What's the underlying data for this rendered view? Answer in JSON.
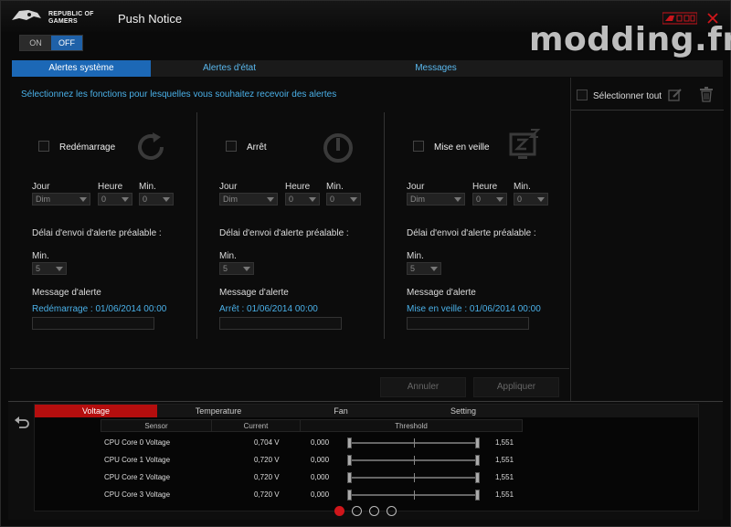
{
  "app": {
    "brand_line1": "REPUBLIC OF",
    "brand_line2": "GAMERS",
    "title": "Push Notice",
    "watermark": "modding.fr"
  },
  "toggle": {
    "on_label": "ON",
    "off_label": "OFF",
    "state": "off"
  },
  "tabs": [
    {
      "label": "Alertes système",
      "active": true
    },
    {
      "label": "Alertes d'état",
      "active": false
    },
    {
      "label": "Messages",
      "active": false
    }
  ],
  "main": {
    "instruction": "Sélectionnez les fonctions pour lesquelles vous souhaitez recevoir des alertes",
    "columns": [
      {
        "title": "Redémarrage",
        "icon": "restart-icon",
        "day_label": "Jour",
        "hour_label": "Heure",
        "min_label": "Min.",
        "day_value": "Dim",
        "hour_value": "0",
        "min_value": "0",
        "delay_label": "Délai d'envoi d'alerte préalable :",
        "delay_min_label": "Min.",
        "delay_value": "5",
        "message_label": "Message d'alerte",
        "message_value": "Redémarrage : 01/06/2014 00:00"
      },
      {
        "title": "Arrêt",
        "icon": "power-icon",
        "day_label": "Jour",
        "hour_label": "Heure",
        "min_label": "Min.",
        "day_value": "Dim",
        "hour_value": "0",
        "min_value": "0",
        "delay_label": "Délai d'envoi d'alerte préalable :",
        "delay_min_label": "Min.",
        "delay_value": "5",
        "message_label": "Message d'alerte",
        "message_value": "Arrêt : 01/06/2014 00:00"
      },
      {
        "title": "Mise en veille",
        "icon": "sleep-icon",
        "day_label": "Jour",
        "hour_label": "Heure",
        "min_label": "Min.",
        "day_value": "Dim",
        "hour_value": "0",
        "min_value": "0",
        "delay_label": "Délai d'envoi d'alerte préalable :",
        "delay_min_label": "Min.",
        "delay_value": "5",
        "message_label": "Message d'alerte",
        "message_value": "Mise en veille : 01/06/2014 00:00"
      }
    ],
    "cancel_label": "Annuler",
    "apply_label": "Appliquer"
  },
  "right": {
    "select_all_label": "Sélectionner tout"
  },
  "monitor": {
    "tabs": [
      {
        "label": "Voltage",
        "active": true
      },
      {
        "label": "Temperature",
        "active": false
      },
      {
        "label": "Fan",
        "active": false
      },
      {
        "label": "Setting",
        "active": false
      }
    ],
    "headers": {
      "sensor": "Sensor",
      "current": "Current",
      "threshold": "Threshold"
    },
    "rows": [
      {
        "sensor": "CPU Core 0 Voltage",
        "current": "0,704 V",
        "min": "0,000",
        "max": "1,551"
      },
      {
        "sensor": "CPU Core 1 Voltage",
        "current": "0,720 V",
        "min": "0,000",
        "max": "1,551"
      },
      {
        "sensor": "CPU Core 2 Voltage",
        "current": "0,720 V",
        "min": "0,000",
        "max": "1,551"
      },
      {
        "sensor": "CPU Core 3 Voltage",
        "current": "0,720 V",
        "min": "0,000",
        "max": "1,551"
      }
    ],
    "pages": 4,
    "active_page": 1
  },
  "colors": {
    "accent_blue": "#1c68b6",
    "link_blue": "#4ab0e8",
    "accent_red": "#b50e0e"
  }
}
